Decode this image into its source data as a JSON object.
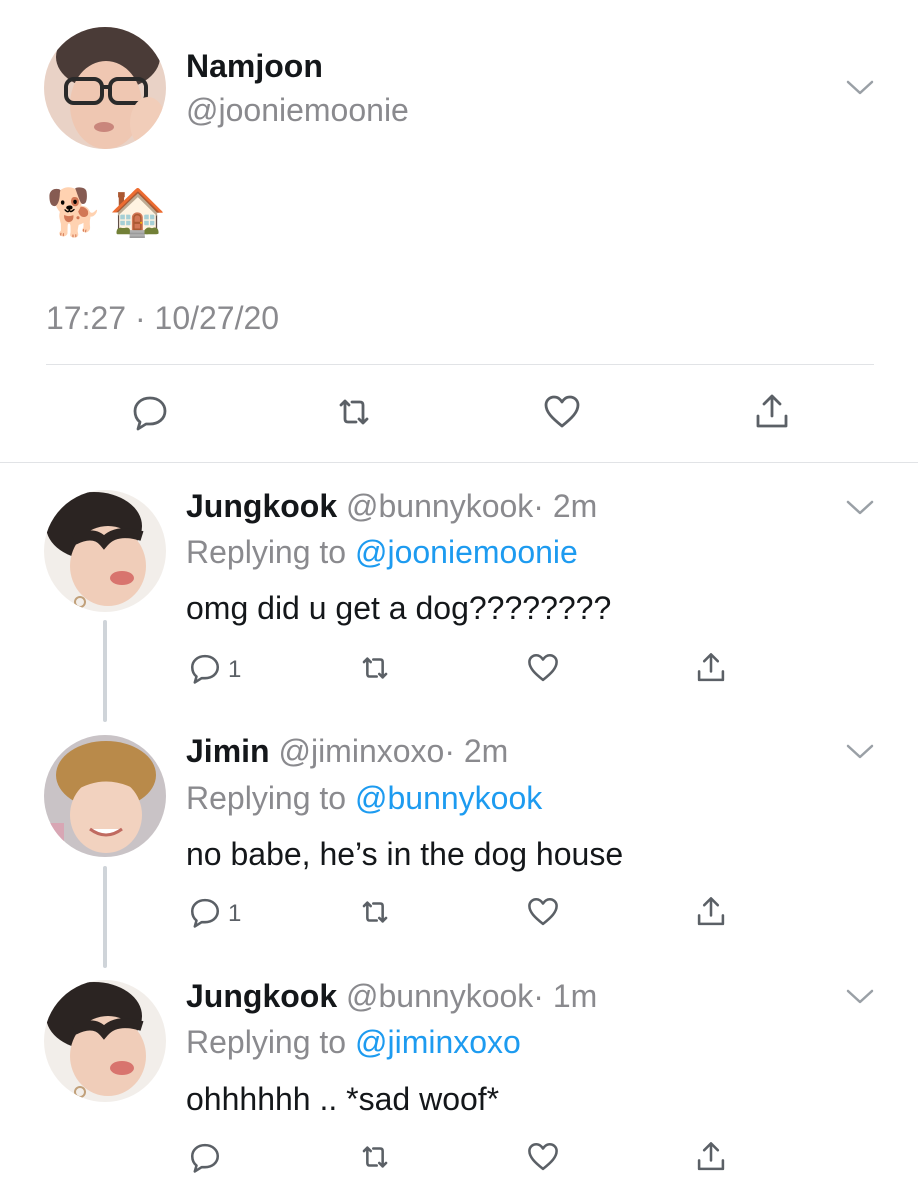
{
  "main_tweet": {
    "avatar": "avatar-namjoon",
    "name": "Namjoon",
    "handle": "@jooniemoonie",
    "text": "🐕🏠",
    "timestamp": "17:27 · 10/27/20",
    "actions": [
      "reply-icon",
      "retweet-icon",
      "like-icon",
      "share-icon"
    ]
  },
  "replies": [
    {
      "name": "Jungkook",
      "handle": "@bunnykook",
      "time": "· 2m",
      "replying_prefix": "Replying to ",
      "replying_to": "@jooniemoonie",
      "text": "omg did u get a dog????????",
      "reply_count": "1"
    },
    {
      "name": "Jimin",
      "handle": "@jiminxoxo",
      "time": "· 2m",
      "replying_prefix": "Replying to ",
      "replying_to": "@bunnykook",
      "text": "no babe, he’s in the dog house",
      "reply_count": "1"
    },
    {
      "name": "Jungkook",
      "handle": "@bunnykook",
      "time": "· 1m",
      "replying_prefix": "Replying to ",
      "replying_to": "@jiminxoxo",
      "text": "ohhhhhh .. *sad woof*",
      "reply_count": ""
    }
  ],
  "colors": {
    "link": "#1d9bf0",
    "muted": "#8a8a8e",
    "icon": "#5b6066",
    "divider": "#e1e3e6"
  }
}
